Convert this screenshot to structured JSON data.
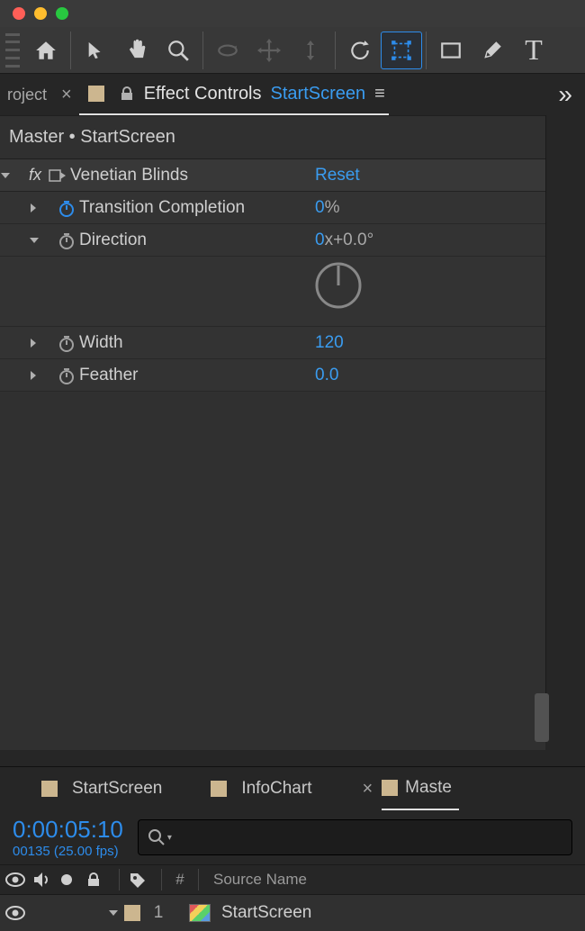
{
  "tabs": {
    "project": "roject",
    "effect_controls": "Effect Controls",
    "layer": "StartScreen"
  },
  "master": "Master • StartScreen",
  "effect": {
    "name": "Venetian Blinds",
    "reset": "Reset",
    "props": {
      "completion": {
        "label": "Transition Completion",
        "val": "0",
        "unit": "%"
      },
      "direction": {
        "label": "Direction",
        "val": "0",
        "extra": "x+0.0°"
      },
      "width": {
        "label": "Width",
        "val": "120"
      },
      "feather": {
        "label": "Feather",
        "val": "0.0"
      }
    }
  },
  "timeline": {
    "tabs": [
      "StartScreen",
      "InfoChart",
      "Maste"
    ],
    "timecode": "0:00:05:10",
    "frames": "00135 (25.00 fps)",
    "col_num": "#",
    "col_source": "Source Name",
    "layer": {
      "index": "1",
      "name": "StartScreen"
    }
  }
}
